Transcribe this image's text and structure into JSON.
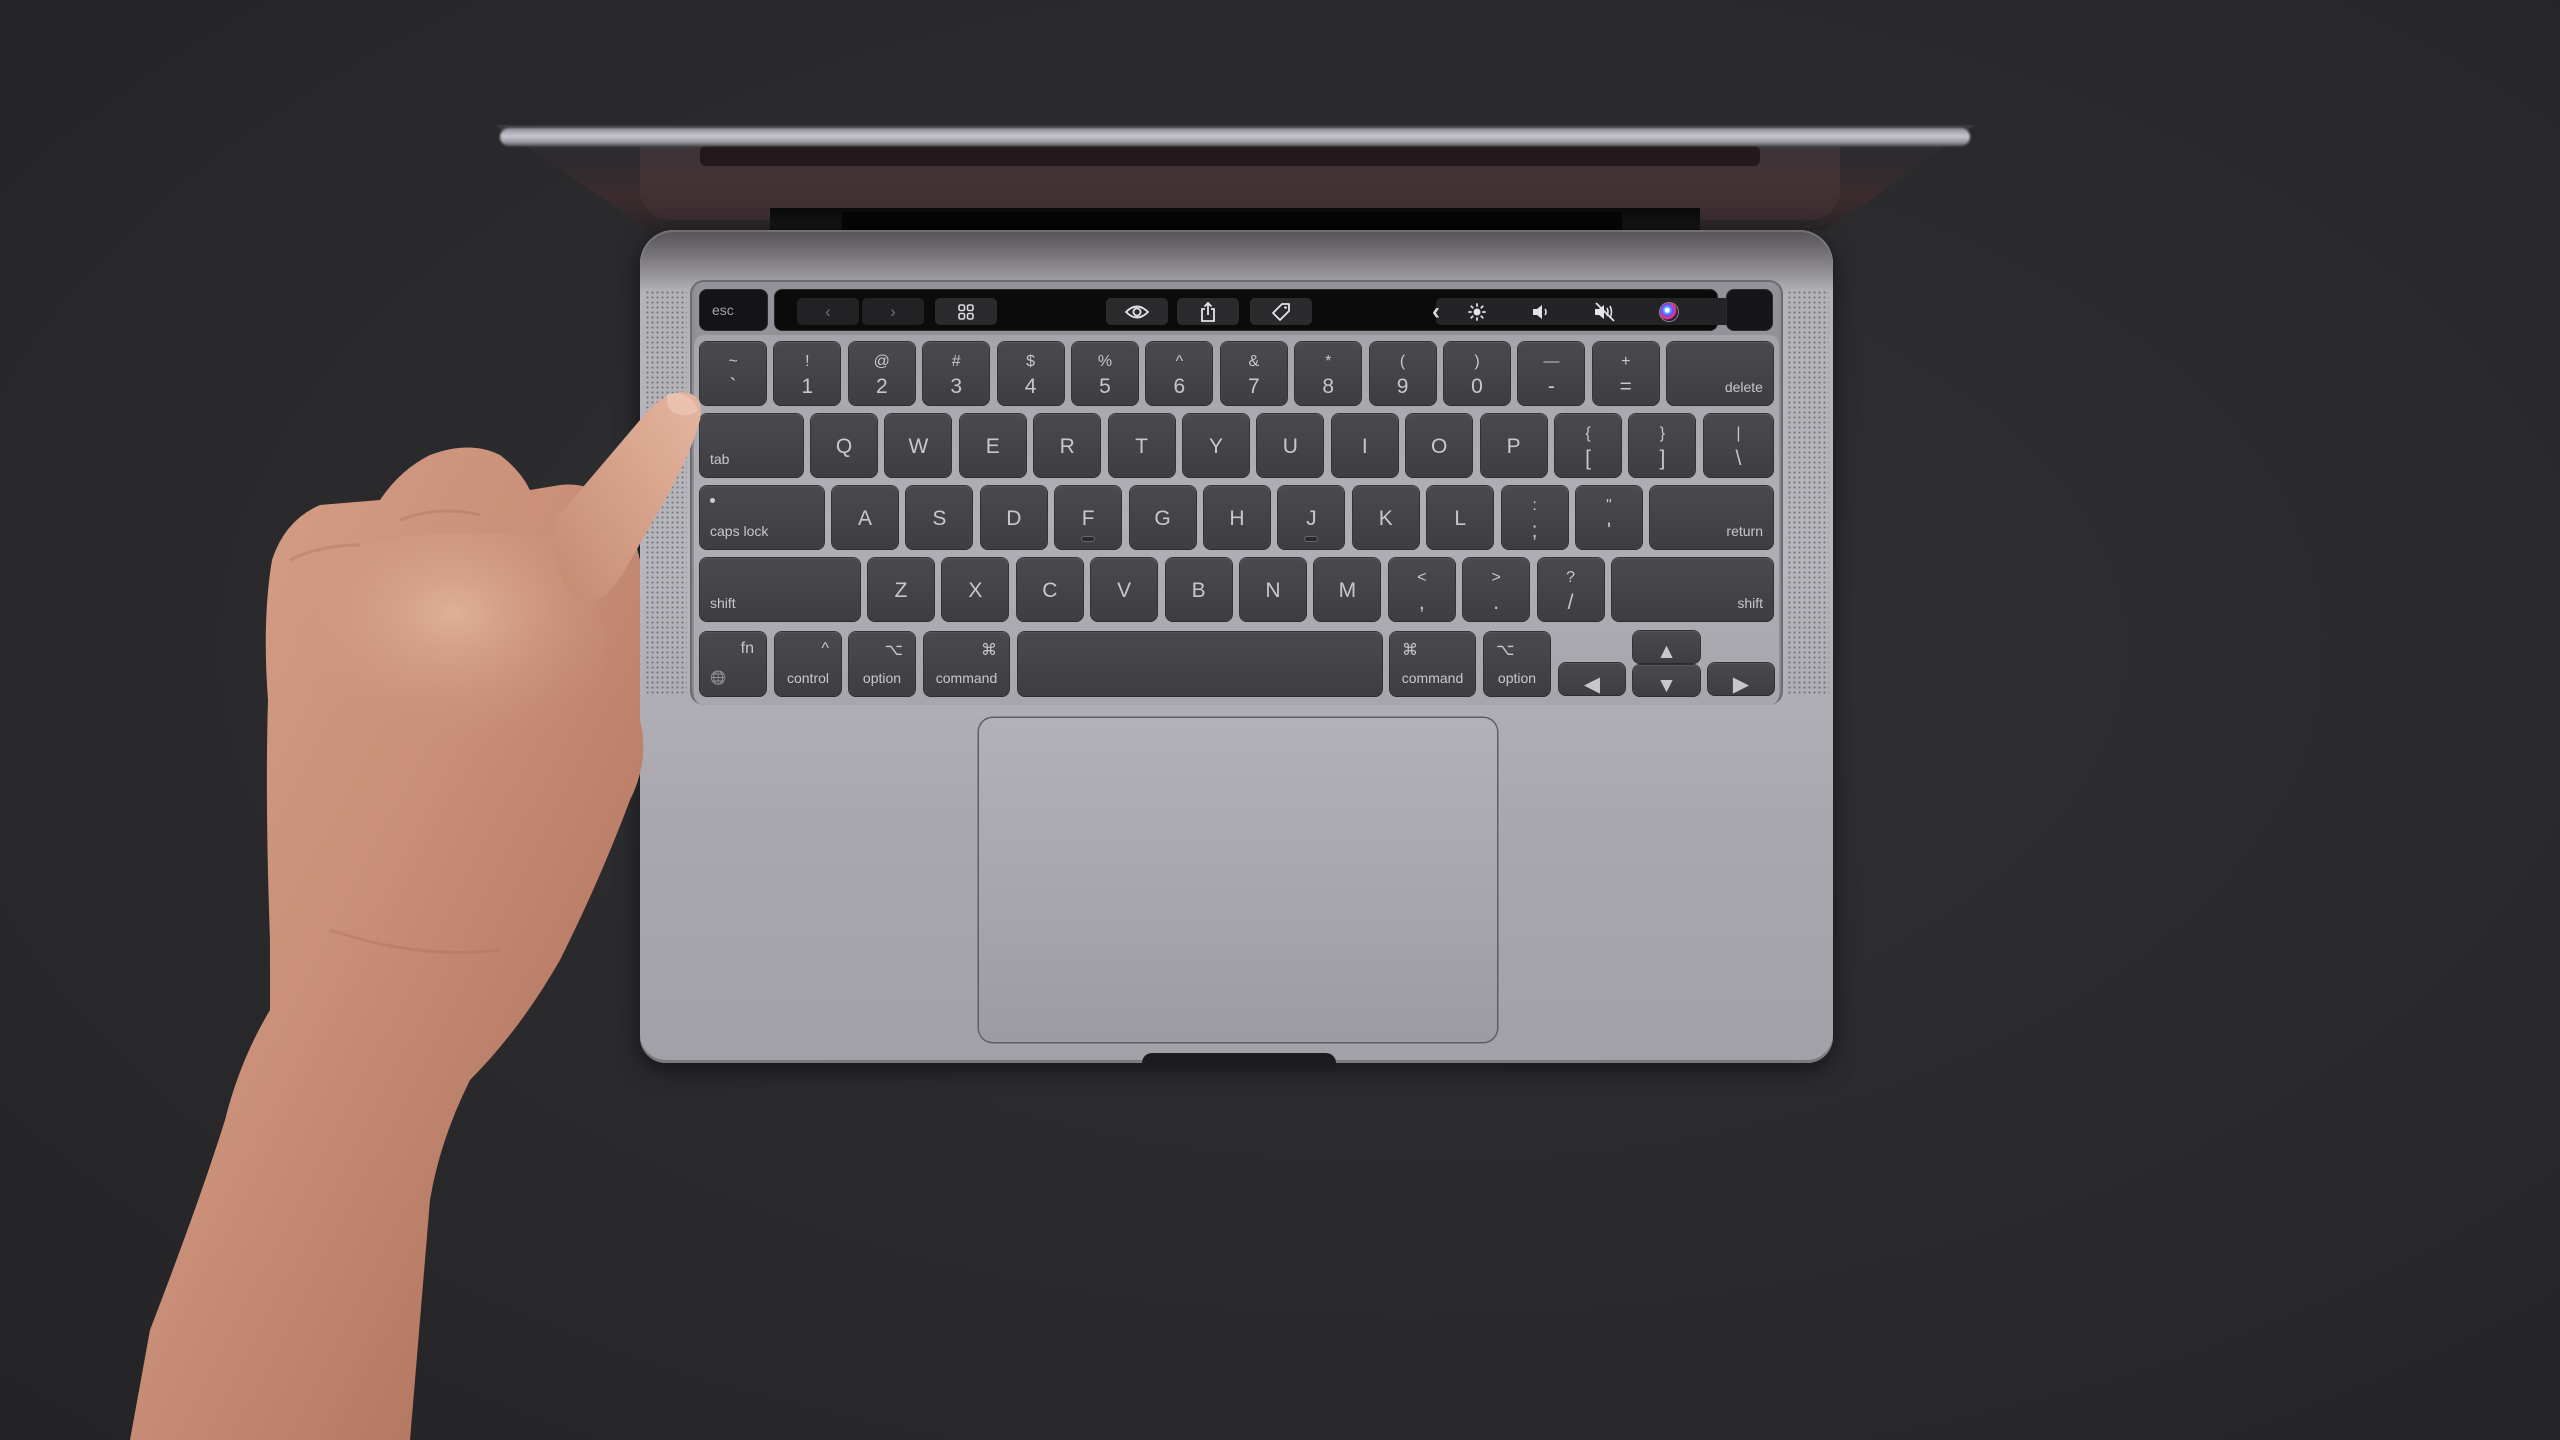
{
  "scene": {
    "description": "Top-down photo of an open space gray laptop with Touch Bar; a hand reaches from the left with index finger near the tab key",
    "colors": {
      "background": "#2b2b2e",
      "chassis": "#b2b1b7",
      "key": "#444448",
      "key_legend": "#c8c8cc",
      "touchbar": "#0b0b0c",
      "skin": "#c98f78"
    }
  },
  "touchbar": {
    "esc": "esc",
    "buttons": [
      {
        "name": "back",
        "glyph": "‹"
      },
      {
        "name": "forward",
        "glyph": "›"
      },
      {
        "name": "grid",
        "glyph": "⊞"
      },
      {
        "name": "quick-look",
        "glyph": "👁"
      },
      {
        "name": "share",
        "glyph": "⇪"
      },
      {
        "name": "tag",
        "glyph": "⌂"
      }
    ],
    "control_strip": [
      {
        "name": "expand",
        "glyph": "‹"
      },
      {
        "name": "brightness",
        "glyph": "✺"
      },
      {
        "name": "volume",
        "glyph": "🔉"
      },
      {
        "name": "mute",
        "glyph": "🔇"
      },
      {
        "name": "siri",
        "glyph": ""
      }
    ]
  },
  "keyboard": {
    "row1": [
      {
        "top": "~",
        "bottom": "`"
      },
      {
        "top": "!",
        "bottom": "1"
      },
      {
        "top": "@",
        "bottom": "2"
      },
      {
        "top": "#",
        "bottom": "3"
      },
      {
        "top": "$",
        "bottom": "4"
      },
      {
        "top": "%",
        "bottom": "5"
      },
      {
        "top": "^",
        "bottom": "6"
      },
      {
        "top": "&",
        "bottom": "7"
      },
      {
        "top": "*",
        "bottom": "8"
      },
      {
        "top": "(",
        "bottom": "9"
      },
      {
        "top": ")",
        "bottom": "0"
      },
      {
        "top": "—",
        "bottom": "-"
      },
      {
        "top": "+",
        "bottom": "="
      }
    ],
    "delete": "delete",
    "tab": "tab",
    "row2": [
      "Q",
      "W",
      "E",
      "R",
      "T",
      "Y",
      "U",
      "I",
      "O",
      "P"
    ],
    "row2_punct": [
      {
        "top": "{",
        "bottom": "["
      },
      {
        "top": "}",
        "bottom": "]"
      },
      {
        "top": "|",
        "bottom": "\\"
      }
    ],
    "caps_lock": "caps lock",
    "row3": [
      "A",
      "S",
      "D",
      "F",
      "G",
      "H",
      "J",
      "K",
      "L"
    ],
    "row3_punct": [
      {
        "top": ":",
        "bottom": ";"
      },
      {
        "top": "\"",
        "bottom": "'"
      }
    ],
    "return": "return",
    "shift_left": "shift",
    "row4": [
      "Z",
      "X",
      "C",
      "V",
      "B",
      "N",
      "M"
    ],
    "row4_punct": [
      {
        "top": "<",
        "bottom": ","
      },
      {
        "top": ">",
        "bottom": "."
      },
      {
        "top": "?",
        "bottom": "/"
      }
    ],
    "shift_right": "shift",
    "bottom_row": {
      "fn": "fn",
      "globe": "🌐",
      "control_symbol": "^",
      "control": "control",
      "option_symbol": "⌥",
      "option": "option",
      "command_symbol": "⌘",
      "command": "command",
      "command_right_symbol": "⌘",
      "command_right": "command",
      "option_right_symbol": "⌥",
      "option_right": "option"
    },
    "arrows": {
      "up": "▲",
      "down": "▼",
      "left": "◀",
      "right": "▶"
    }
  }
}
